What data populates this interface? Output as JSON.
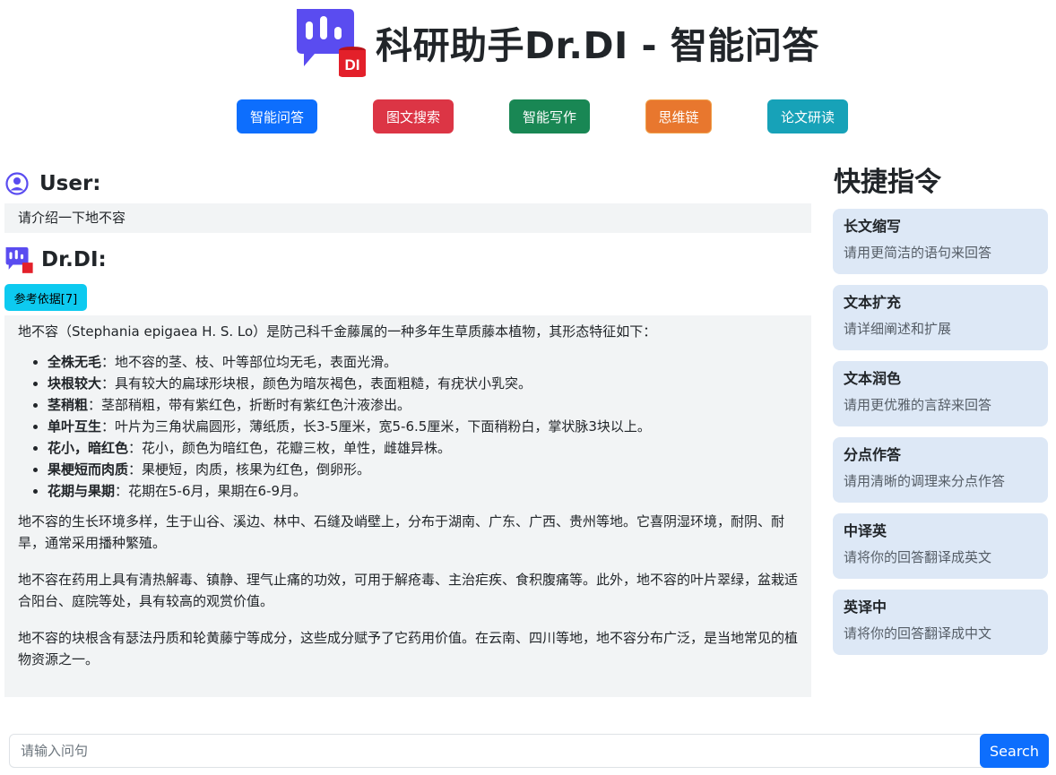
{
  "header": {
    "title": "科研助手Dr.DI - 智能问答",
    "logo_text": "DI"
  },
  "nav": [
    {
      "label": "智能问答",
      "color": "#0d6efd"
    },
    {
      "label": "图文搜索",
      "color": "#dc3545"
    },
    {
      "label": "智能写作",
      "color": "#198754"
    },
    {
      "label": "思维链",
      "color": "#e8772e"
    },
    {
      "label": "论文研读",
      "color": "#17a2b8"
    }
  ],
  "chat": {
    "user_label": "User:",
    "user_message": "请介绍一下地不容",
    "assistant_label": "Dr.DI:",
    "reference_button": "参考依据[7]",
    "answer": {
      "intro": "地不容（Stephania epigaea H. S. Lo）是防己科千金藤属的一种多年生草质藤本植物，其形态特征如下：",
      "features": [
        {
          "term": "全株无毛",
          "text": "：地不容的茎、枝、叶等部位均无毛，表面光滑。"
        },
        {
          "term": "块根较大",
          "text": "：具有较大的扁球形块根，颜色为暗灰褐色，表面粗糙，有疣状小乳突。"
        },
        {
          "term": "茎稍粗",
          "text": "：茎部稍粗，带有紫红色，折断时有紫红色汁液渗出。"
        },
        {
          "term": "单叶互生",
          "text": "：叶片为三角状扁圆形，薄纸质，长3-5厘米，宽5-6.5厘米，下面稍粉白，掌状脉3块以上。"
        },
        {
          "term": "花小，暗红色",
          "text": "：花小，颜色为暗红色，花瓣三枚，单性，雌雄异株。"
        },
        {
          "term": "果梗短而肉质",
          "text": "：果梗短，肉质，核果为红色，倒卵形。"
        },
        {
          "term": "花期与果期",
          "text": "：花期在5-6月，果期在6-9月。"
        }
      ],
      "paragraph_1": "地不容的生长环境多样，生于山谷、溪边、林中、石缝及峭壁上，分布于湖南、广东、广西、贵州等地。它喜阴湿环境，耐阴、耐旱，通常采用播种繁殖。",
      "paragraph_2": "地不容在药用上具有清热解毒、镇静、理气止痛的功效，可用于解疮毒、主治疟疾、食积腹痛等。此外，地不容的叶片翠绿，盆栽适合阳台、庭院等处，具有较高的观赏价值。",
      "paragraph_3": "地不容的块根含有瑟法丹质和轮黄藤宁等成分，这些成分赋予了它药用价值。在云南、四川等地，地不容分布广泛，是当地常见的植物资源之一。"
    }
  },
  "sidebar": {
    "title": "快捷指令",
    "commands": [
      {
        "title": "长文缩写",
        "desc": "请用更简洁的语句来回答"
      },
      {
        "title": "文本扩充",
        "desc": "请详细阐述和扩展"
      },
      {
        "title": "文本润色",
        "desc": "请用更优雅的言辞来回答"
      },
      {
        "title": "分点作答",
        "desc": "请用清晰的调理来分点作答"
      },
      {
        "title": "中译英",
        "desc": "请将你的回答翻译成英文"
      },
      {
        "title": "英译中",
        "desc": "请将你的回答翻译成中文"
      }
    ]
  },
  "search": {
    "placeholder": "请输入问句",
    "button_label": "Search"
  }
}
